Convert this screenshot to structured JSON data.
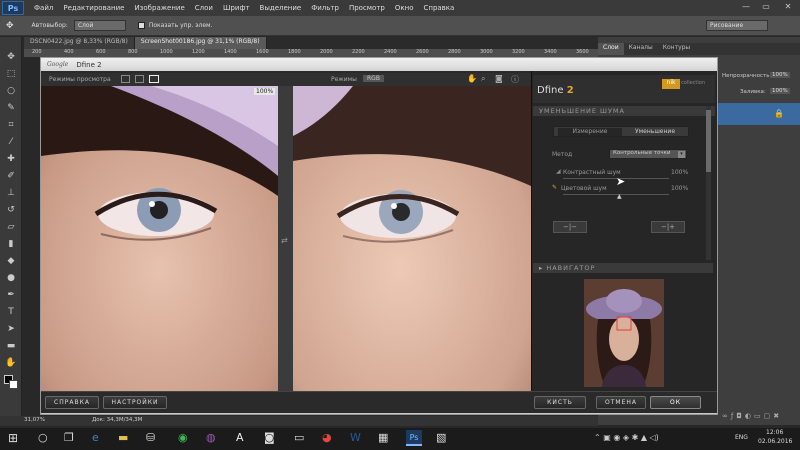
{
  "menubar": {
    "logo": "Ps",
    "items": [
      "Файл",
      "Редактирование",
      "Изображение",
      "Слои",
      "Шрифт",
      "Выделение",
      "Фильтр",
      "Просмотр",
      "Окно",
      "Справка"
    ]
  },
  "optbar": {
    "autoselect": "Автовыбор:",
    "layer_select": "Слой",
    "show_controls": "Показать упр. элем.",
    "workspace": "Рисование"
  },
  "doc_tabs": [
    "DSCN0422.jpg @ 8,33% (RGB/8)",
    "ScreenShot00186.jpg @ 31,1% (RGB/8)"
  ],
  "ruler_ticks": [
    "200",
    "400",
    "600",
    "800",
    "1000",
    "1200",
    "1400",
    "1600",
    "1800",
    "2000",
    "2200",
    "2400",
    "2600",
    "2800",
    "3000",
    "3200",
    "3400",
    "3600"
  ],
  "right_panel": {
    "tabs": [
      "Слои",
      "Каналы",
      "Контуры"
    ],
    "opacity_label": "Непрозрачность:",
    "fill_label": "Заливка:",
    "opacity_value": "100%",
    "fill_value": "100%"
  },
  "dialog": {
    "brand": "Google",
    "title": "Dfine 2",
    "view_modes_label": "Режимы просмотра",
    "zoom": "100%",
    "modes_label": "Режимы",
    "mode_value": "RGB",
    "panel_title": "Dfine",
    "panel_title_num": "2",
    "nik": "nik",
    "collection": "collection",
    "noise_section": "УМЕНЬШЕНИЕ ШУМА",
    "tab_measure": "Измерение",
    "tab_reduce": "Уменьшение",
    "method_label": "Метод",
    "method_value": "Контрольные точки",
    "contrast_noise": "Контрастный шум",
    "contrast_value": "100%",
    "color_noise": "Цветовой шум",
    "color_value": "100%",
    "navigator": "НАВИГАТОР",
    "btn_help": "СПРАВКА",
    "btn_settings": "НАСТРОЙКИ",
    "btn_brush": "КИСТЬ",
    "btn_cancel": "ОТМЕНА",
    "btn_ok": "ОК"
  },
  "status": {
    "zoom": "31,07%",
    "doc": "Док: 34,3M/34,3M"
  },
  "taskbar": {
    "lang": "ENG",
    "time": "12:06",
    "date": "02.06.2016"
  }
}
